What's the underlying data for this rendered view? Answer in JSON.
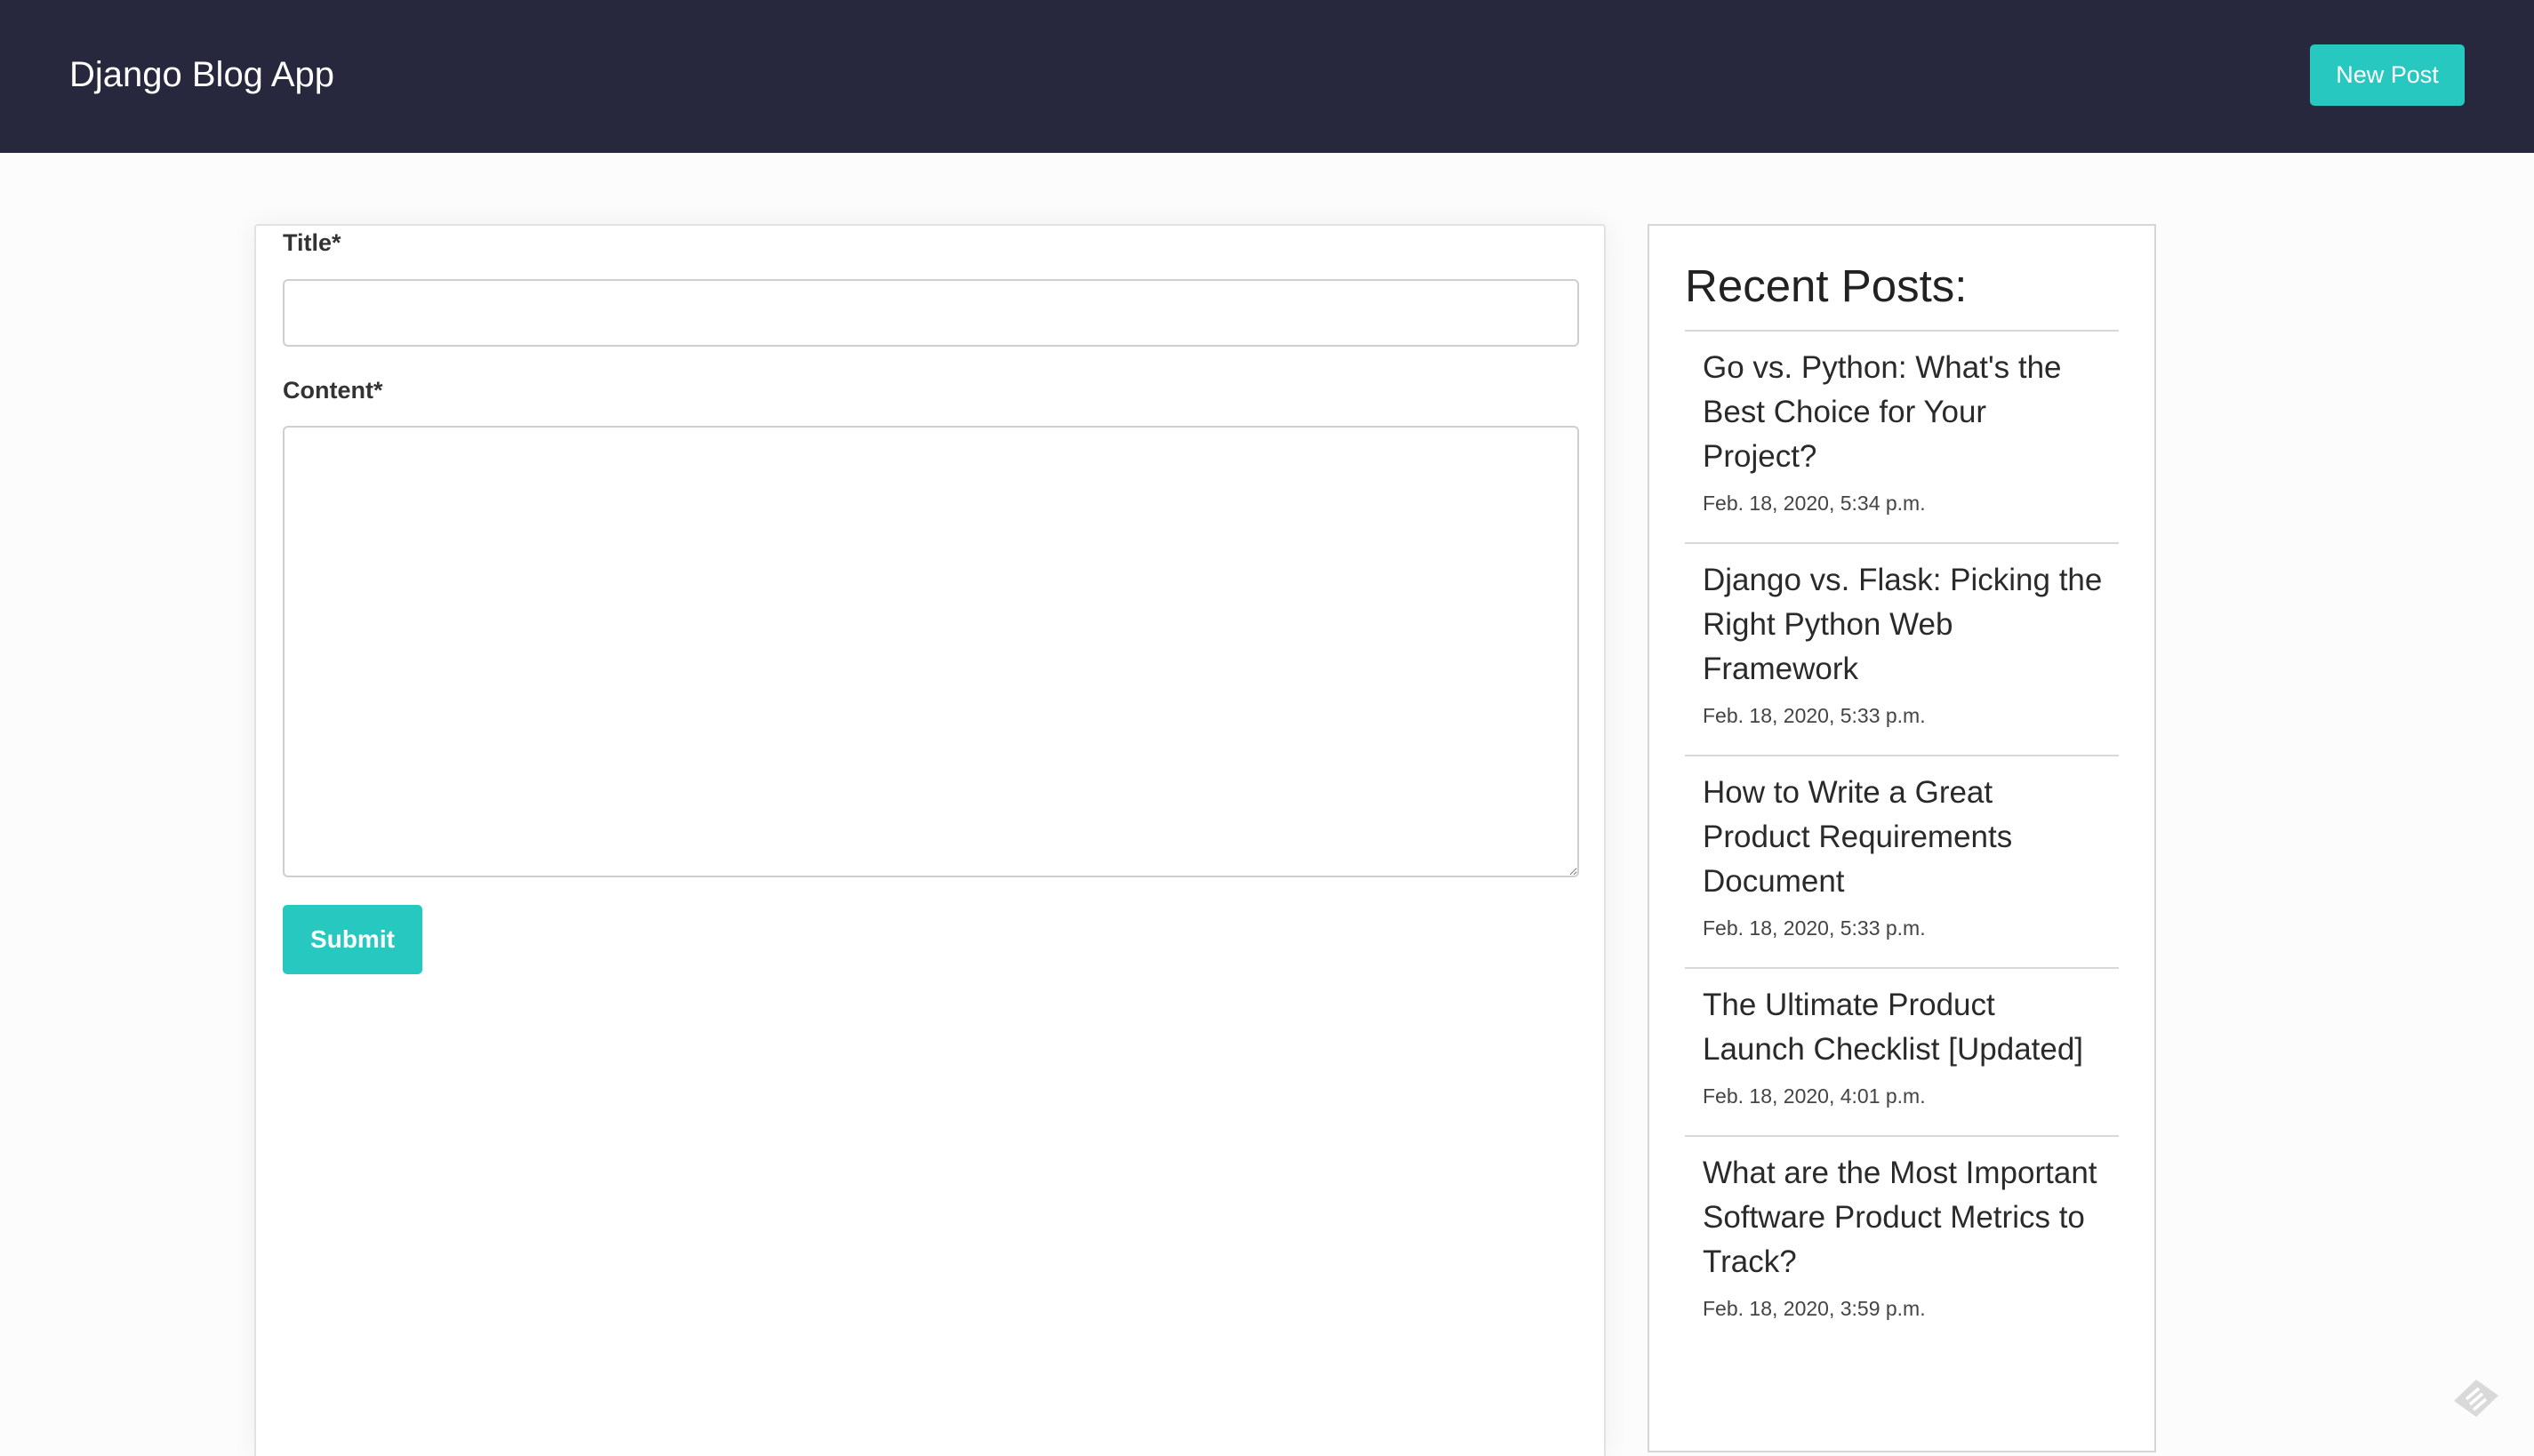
{
  "header": {
    "brand": "Django Blog App",
    "new_post_label": "New Post"
  },
  "form": {
    "title_label": "Title*",
    "title_value": "",
    "content_label": "Content*",
    "content_value": "",
    "submit_label": "Submit"
  },
  "sidebar": {
    "heading": "Recent Posts:",
    "posts": [
      {
        "title": "Go vs. Python: What's the Best Choice for Your Project?",
        "date": "Feb. 18, 2020, 5:34 p.m."
      },
      {
        "title": "Django vs. Flask: Picking the Right Python Web Framework",
        "date": "Feb. 18, 2020, 5:33 p.m."
      },
      {
        "title": "How to Write a Great Product Requirements Document",
        "date": "Feb. 18, 2020, 5:33 p.m."
      },
      {
        "title": "The Ultimate Product Launch Checklist [Updated]",
        "date": "Feb. 18, 2020, 4:01 p.m."
      },
      {
        "title": "What are the Most Important Software Product Metrics to Track?",
        "date": "Feb. 18, 2020, 3:59 p.m."
      }
    ]
  },
  "colors": {
    "navbar": "#27273d",
    "accent": "#27c8c0",
    "background": "#fcfcfc"
  },
  "icons": {
    "corner": "feedback-logo-icon"
  }
}
